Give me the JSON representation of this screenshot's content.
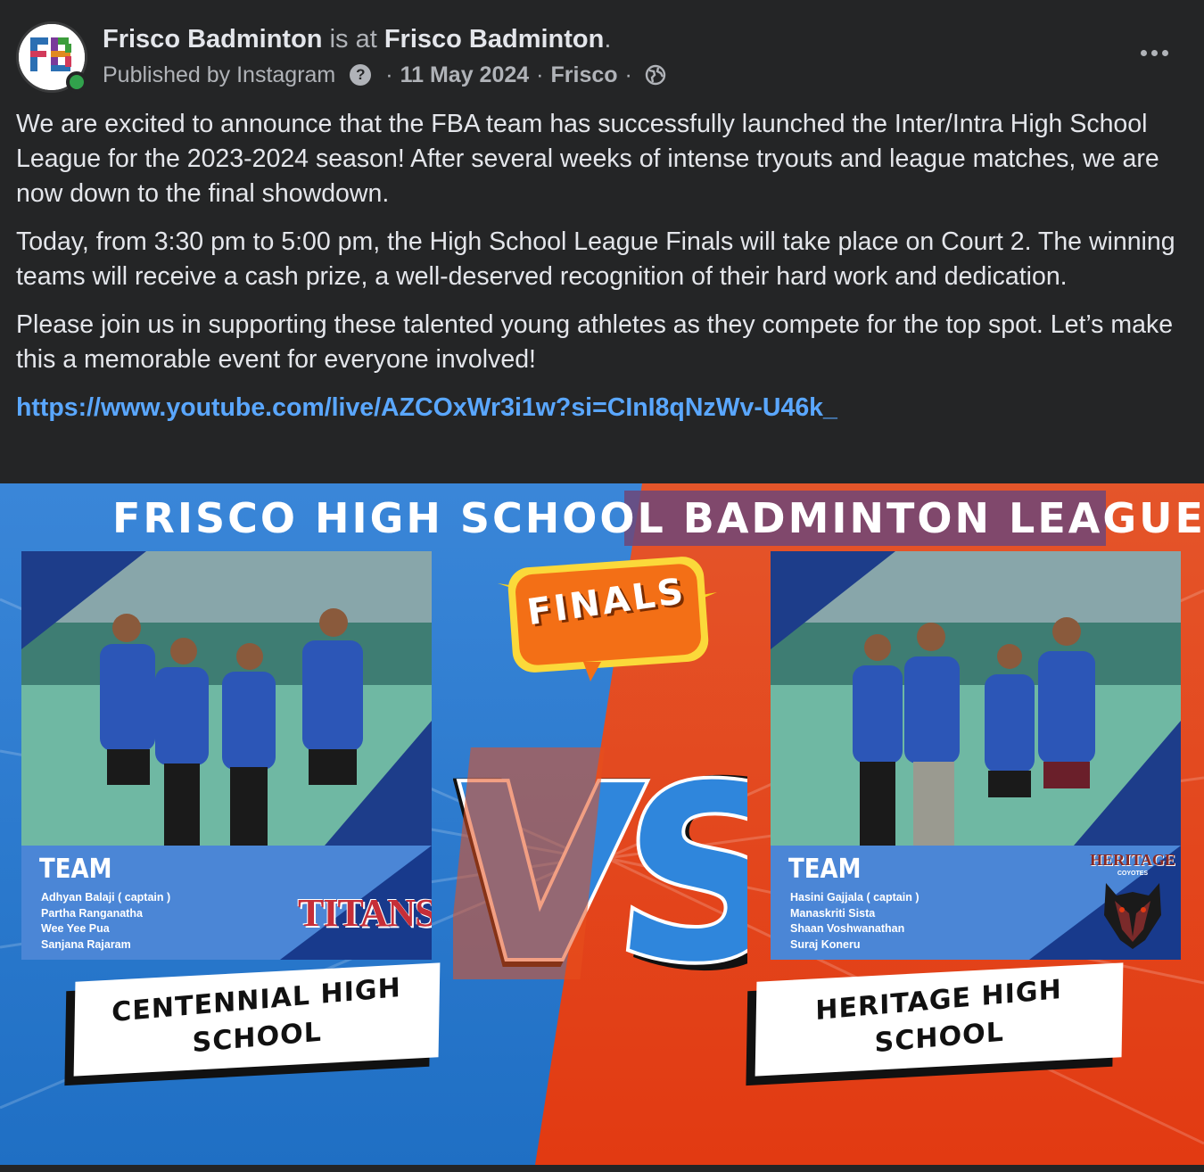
{
  "header": {
    "page_name": "Frisco Badminton",
    "is_at": " is at ",
    "location": "Frisco Badminton",
    "period": ".",
    "published_by": "Published by Instagram",
    "help_icon_glyph": "?",
    "date": "11 May 2024",
    "place": "Frisco",
    "separator": "·",
    "privacy_icon": "globe-icon",
    "more_icon": "more-options-icon",
    "avatar_text": "FB",
    "online_color": "#31a24c"
  },
  "post": {
    "paragraphs": [
      "We are excited to announce that the FBA team has successfully launched the Inter/Intra High School League for the 2023-2024 season! After several weeks of intense tryouts and league matches, we are now down to the final showdown.",
      "Today, from 3:30 pm to 5:00 pm, the High School League Finals will take place on Court 2. The winning teams will receive a cash prize, a well-deserved recognition of their hard work and dedication.",
      "Please join us in supporting these talented young athletes as they compete for the top spot. Let’s make this a memorable event for everyone involved!"
    ],
    "link": "https://www.youtube.com/live/AZCOxWr3i1w?si=CInI8qNzWv-U46k_",
    "link_color": "#5aa7ff"
  },
  "poster": {
    "title": "FRISCO HIGH SCHOOL BADMINTON LEAGUE",
    "badge": "FINALS",
    "versus": "VS",
    "left_team": {
      "heading": "TEAM",
      "members": [
        "Adhyan Balaji ( captain )",
        "Partha Ranganatha",
        "Wee Yee Pua",
        "Sanjana Rajaram"
      ],
      "logo_text": "TITANS",
      "school": "CENTENNIAL HIGH\nSCHOOL"
    },
    "right_team": {
      "heading": "TEAM",
      "members": [
        "Hasini Gajjala ( captain )",
        "Manaskriti Sista",
        "Shaan Voshwanathan",
        "Suraj Koneru"
      ],
      "logo_text": "HERITAGE",
      "logo_subtext": "COYOTES",
      "school": "HERITAGE HIGH\nSCHOOL"
    },
    "colors": {
      "left_side": "#2f8fe0",
      "right_side": "#e8501e",
      "accent_orange": "#f36f16",
      "team_box": "#4b86d6"
    }
  }
}
